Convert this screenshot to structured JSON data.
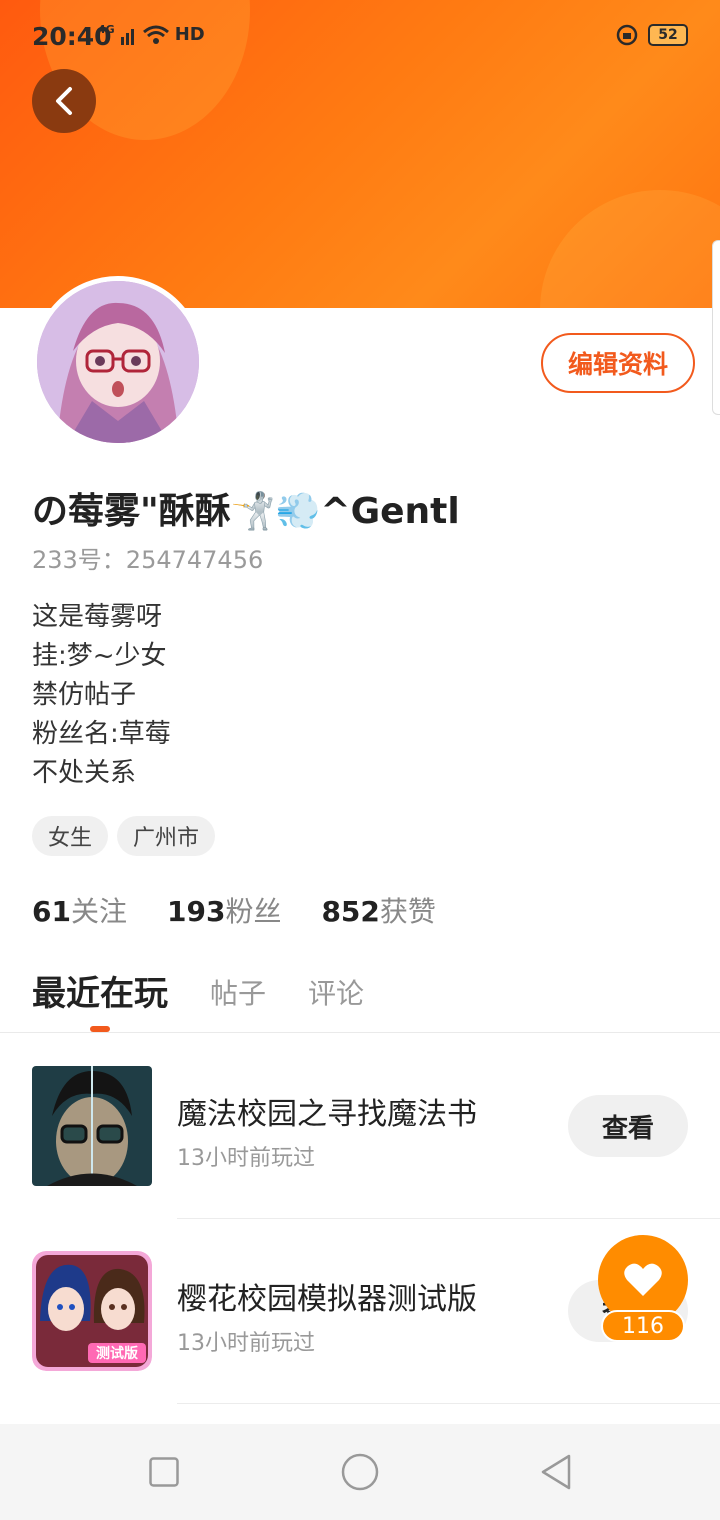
{
  "status_bar": {
    "time": "20:40",
    "network": "4G",
    "hd": "HD",
    "battery": "52"
  },
  "profile": {
    "username": "の莓雾\"酥酥🤺💨^Gentl",
    "id_label": "233号：254747456",
    "edit_label": "编辑资料",
    "bio": [
      "这是莓雾呀",
      "挂:梦~少女",
      "禁仿帖子",
      "粉丝名:草莓",
      "不处关系"
    ],
    "tags": [
      "女生",
      "广州市"
    ],
    "stats": [
      {
        "value": "61",
        "label": "关注"
      },
      {
        "value": "193",
        "label": "粉丝"
      },
      {
        "value": "852",
        "label": "获赞"
      }
    ]
  },
  "tabs": [
    "最近在玩",
    "帖子",
    "评论"
  ],
  "games": [
    {
      "name": "魔法校园之寻找魔法书",
      "time": "13小时前玩过",
      "action": "查看"
    },
    {
      "name": "樱花校园模拟器测试版",
      "time": "13小时前玩过",
      "action": "查看",
      "thumb_badge": "测试版"
    }
  ],
  "like": {
    "count": "116"
  },
  "colors": {
    "accent": "#f25a1d",
    "like": "#ff8c00",
    "header": "#ff6a12"
  }
}
